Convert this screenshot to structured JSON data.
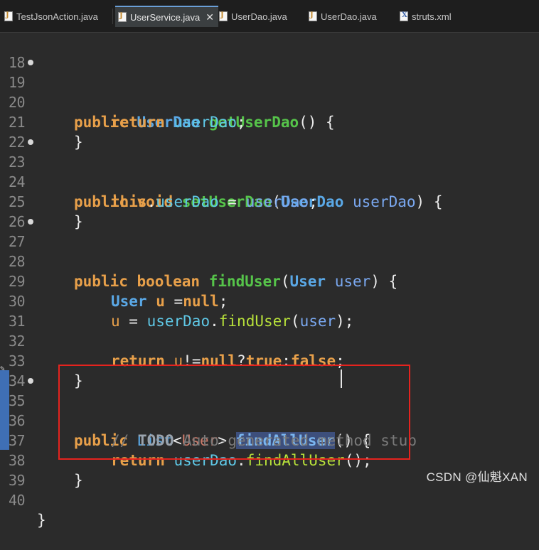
{
  "tabs": [
    {
      "label": "TestJsonAction.java",
      "icon": "java-file-icon"
    },
    {
      "label": "UserService.java",
      "icon": "java-file-icon",
      "active": true,
      "close": "✕"
    },
    {
      "label": "UserDao.java",
      "icon": "java-file-icon"
    },
    {
      "label": "UserDao.java",
      "icon": "java-file-icon"
    },
    {
      "label": "struts.xml",
      "icon": "xml-file-icon"
    }
  ],
  "editor": {
    "line_numbers": [
      "18",
      "19",
      "20",
      "21",
      "22",
      "23",
      "24",
      "25",
      "26",
      "27",
      "28",
      "29",
      "30",
      "31",
      "32",
      "33",
      "34",
      "35",
      "36",
      "37",
      "38",
      "39",
      "40"
    ],
    "code": {
      "l19": {
        "kw1": "public",
        "type": "UserDao",
        "method": "getUserDao",
        "rest": "() {"
      },
      "l20": {
        "kw": "return",
        "field": "userDao",
        "rest": ";"
      },
      "l21": {
        "rest": "}"
      },
      "l23": {
        "kw1": "public",
        "kw2": "void",
        "method": "setUserDao",
        "p1": "(",
        "type": "UserDao",
        "param": "userDao",
        "rest": ") {"
      },
      "l24": {
        "kw": "this",
        "dot": ".",
        "field": "userDao",
        "eq": " = ",
        "param": "userDao",
        "rest": ";"
      },
      "l25": {
        "rest": "}"
      },
      "l27": {
        "kw1": "public",
        "kw2": "boolean",
        "method": "findUser",
        "p1": "(",
        "type": "User",
        "param": "user",
        "rest": ") {"
      },
      "l29": {
        "type": "User",
        "var": "u",
        "eq": " =",
        "kw": "null",
        "rest": ";"
      },
      "l30": {
        "var": "u",
        "eq": " = ",
        "field": "userDao",
        "dot": ".",
        "mcall": "findUser",
        "p1": "(",
        "param": "user",
        "rest": ");"
      },
      "l32": {
        "kw": "return",
        "var": "u",
        "op1": "!=",
        "kw2": "null",
        "op2": "?",
        "kw3": "true",
        "op3": ":",
        "kw4": "false",
        "rest": ";"
      },
      "l33": {
        "rest": "}"
      },
      "l35": {
        "kw1": "public",
        "type": "List",
        "lt": "<",
        "gen": "User",
        "gt": ">",
        "method": "findAllUser",
        "rest": "() {"
      },
      "l36": {
        "slashes": "// ",
        "todo": "TODO",
        "text": " Auto-generated method stub"
      },
      "l37": {
        "kw": "return",
        "field": "userDao",
        "dot": ".",
        "mcall": "findAllUser",
        "rest": "();"
      },
      "l38": {
        "rest": "}"
      },
      "l40": {
        "rest": "}"
      }
    }
  },
  "watermark": "CSDN @仙魁XAN",
  "colors": {
    "background": "#2b2b2b",
    "keyword": "#e8a04a",
    "type": "#5aa8e6",
    "method": "#56c44a",
    "highlight_box": "#e5231e"
  }
}
